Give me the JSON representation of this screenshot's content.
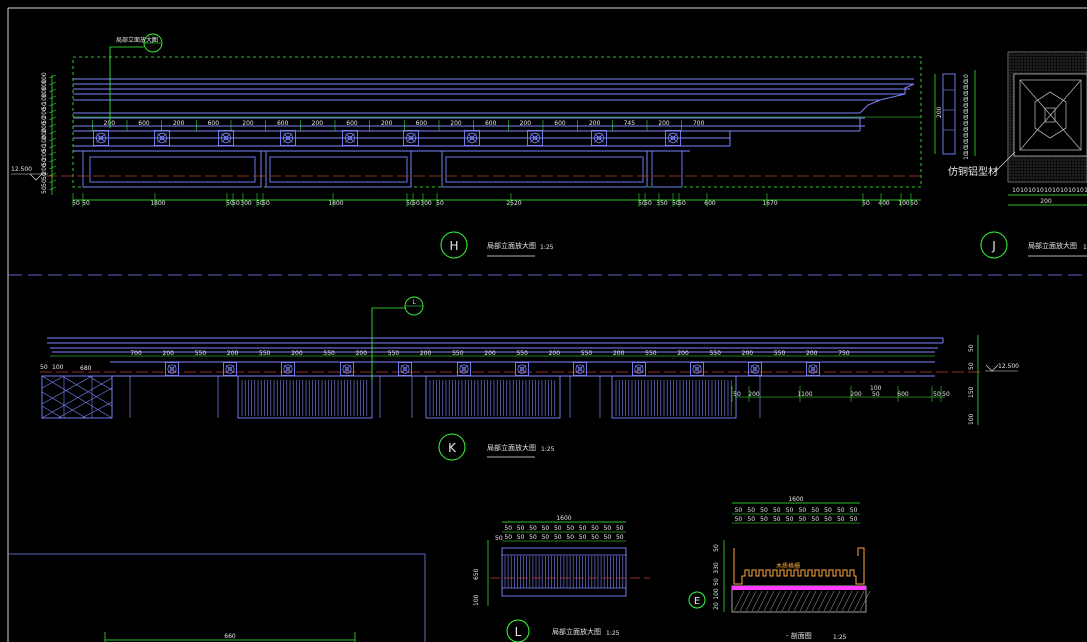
{
  "drawing": {
    "colors": {
      "background": "#000000",
      "outline": "#7b86ff",
      "dimension": "#3cff3c",
      "frame": "#d8d8d8",
      "centerline": "#c23a2a",
      "marker": "#39ff39",
      "magenta": "#ff3cff",
      "orange": "#ffa93a",
      "hatch": "#b0b0b0"
    },
    "elevation_h": {
      "marker": "H",
      "title": "局部立面放大图",
      "scale": "1:25",
      "callout": "J",
      "callout_note": "局部立面放大图",
      "level": "12.500",
      "top_dims": [
        "200",
        "600",
        "200",
        "600",
        "200",
        "600",
        "200",
        "600",
        "200",
        "600",
        "200",
        "600",
        "200",
        "600",
        "200",
        "745",
        "200",
        "700"
      ],
      "bottom_dims": [
        "50",
        "50",
        "1800",
        "50",
        "50",
        "300",
        "50",
        "50",
        "1800",
        "50",
        "50",
        "300",
        "50",
        "2520",
        "50",
        "50",
        "350",
        "50",
        "50",
        "600",
        "1670",
        "50",
        "400",
        "100",
        "50"
      ],
      "left_dims": [
        "100",
        "100",
        "100",
        "100",
        "50",
        "200",
        "50",
        "200",
        "200",
        "100",
        "50",
        "200",
        "50",
        "200",
        "50",
        "50",
        "50"
      ]
    },
    "elevation_j": {
      "marker": "J",
      "title": "局部立面放大图",
      "scale": "1",
      "material_label": "仿铜铝型材",
      "left_dim": "200",
      "right_dims": [
        "10",
        "10",
        "10",
        "10",
        "10",
        "10",
        "10",
        "10",
        "10",
        "10",
        "10",
        "10",
        "10",
        "10"
      ],
      "bottom_dims": [
        "10",
        "10",
        "10",
        "10",
        "10",
        "10",
        "10",
        "10",
        "10",
        "10"
      ],
      "bottom_total": "200"
    },
    "elevation_k": {
      "marker": "K",
      "title": "局部立面放大图",
      "scale": "1:25",
      "callout": "L",
      "level": "12.500",
      "top_dims": [
        "700",
        "200",
        "550",
        "200",
        "550",
        "200",
        "550",
        "200",
        "550",
        "200",
        "550",
        "200",
        "550",
        "200",
        "550",
        "200",
        "550",
        "200",
        "550",
        "200",
        "550",
        "200",
        "750"
      ],
      "left_dims": [
        "50",
        "100",
        "680"
      ],
      "right_dims": [
        "50",
        "50",
        "150",
        "100"
      ],
      "bottom_dims": [
        "50",
        "200",
        "1100",
        "200",
        "600",
        "50",
        "50"
      ],
      "bottom_small": [
        "100",
        "50"
      ]
    },
    "elevation_l": {
      "marker": "L",
      "title": "局部立面放大图",
      "scale": "1:25",
      "top_total": "1600",
      "top_dims": [
        "50",
        "50",
        "50",
        "50",
        "50",
        "50",
        "50",
        "50",
        "50",
        "50",
        "50",
        "50",
        "50",
        "50",
        "50",
        "50",
        "50",
        "50",
        "50",
        "50"
      ],
      "side_dims": [
        "50",
        "650",
        "100"
      ]
    },
    "section_e": {
      "marker": "E",
      "title": "-  剖面图",
      "scale": "1:25",
      "top_total": "1600",
      "top_dims": [
        "50",
        "50",
        "50",
        "50",
        "50",
        "50",
        "50",
        "50",
        "50",
        "50",
        "50",
        "50",
        "50",
        "50",
        "50",
        "50",
        "50",
        "50",
        "50",
        "50"
      ],
      "note": "木质格栅",
      "side_dims": [
        "50",
        "330",
        "50",
        "100",
        "20"
      ]
    },
    "bottom_left": {
      "dim": "660"
    }
  }
}
